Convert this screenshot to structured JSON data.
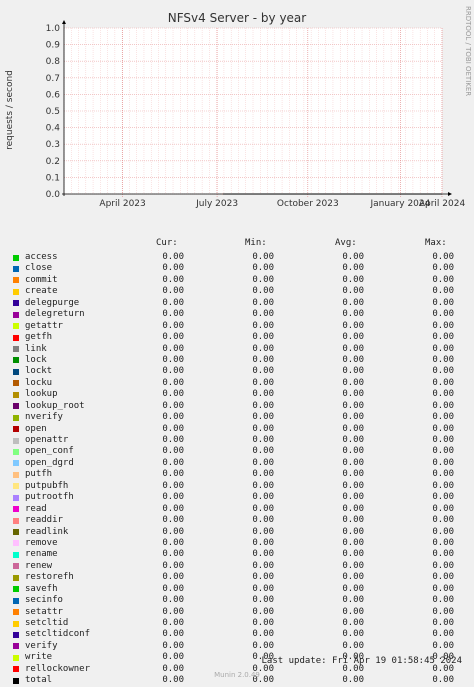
{
  "chart_data": {
    "type": "line",
    "title": "NFSv4 Server - by year",
    "ylabel": "requests / second",
    "xlabel": "",
    "ylim": [
      0,
      1
    ],
    "yticks": [
      "0.0",
      "0.1",
      "0.2",
      "0.3",
      "0.4",
      "0.5",
      "0.6",
      "0.7",
      "0.8",
      "0.9",
      "1.0"
    ],
    "xticks": [
      "April 2023",
      "July 2023",
      "October 2023",
      "January 2024",
      "April 2024"
    ],
    "grid": true,
    "watermark": "RRDTOOL / TOBI OETIKER",
    "series": [
      {
        "name": "access",
        "color": "#00cc00",
        "cur": "0.00",
        "min": "0.00",
        "avg": "0.00",
        "max": "0.00"
      },
      {
        "name": "close",
        "color": "#0066b3",
        "cur": "0.00",
        "min": "0.00",
        "avg": "0.00",
        "max": "0.00"
      },
      {
        "name": "commit",
        "color": "#ff8000",
        "cur": "0.00",
        "min": "0.00",
        "avg": "0.00",
        "max": "0.00"
      },
      {
        "name": "create",
        "color": "#ffcc00",
        "cur": "0.00",
        "min": "0.00",
        "avg": "0.00",
        "max": "0.00"
      },
      {
        "name": "delegpurge",
        "color": "#330099",
        "cur": "0.00",
        "min": "0.00",
        "avg": "0.00",
        "max": "0.00"
      },
      {
        "name": "delegreturn",
        "color": "#990099",
        "cur": "0.00",
        "min": "0.00",
        "avg": "0.00",
        "max": "0.00"
      },
      {
        "name": "getattr",
        "color": "#ccff00",
        "cur": "0.00",
        "min": "0.00",
        "avg": "0.00",
        "max": "0.00"
      },
      {
        "name": "getfh",
        "color": "#ff0000",
        "cur": "0.00",
        "min": "0.00",
        "avg": "0.00",
        "max": "0.00"
      },
      {
        "name": "link",
        "color": "#808080",
        "cur": "0.00",
        "min": "0.00",
        "avg": "0.00",
        "max": "0.00"
      },
      {
        "name": "lock",
        "color": "#008f00",
        "cur": "0.00",
        "min": "0.00",
        "avg": "0.00",
        "max": "0.00"
      },
      {
        "name": "lockt",
        "color": "#00487d",
        "cur": "0.00",
        "min": "0.00",
        "avg": "0.00",
        "max": "0.00"
      },
      {
        "name": "locku",
        "color": "#b35a00",
        "cur": "0.00",
        "min": "0.00",
        "avg": "0.00",
        "max": "0.00"
      },
      {
        "name": "lookup",
        "color": "#b38f00",
        "cur": "0.00",
        "min": "0.00",
        "avg": "0.00",
        "max": "0.00"
      },
      {
        "name": "lookup_root",
        "color": "#6b006b",
        "cur": "0.00",
        "min": "0.00",
        "avg": "0.00",
        "max": "0.00"
      },
      {
        "name": "nverify",
        "color": "#8fb300",
        "cur": "0.00",
        "min": "0.00",
        "avg": "0.00",
        "max": "0.00"
      },
      {
        "name": "open",
        "color": "#b30000",
        "cur": "0.00",
        "min": "0.00",
        "avg": "0.00",
        "max": "0.00"
      },
      {
        "name": "openattr",
        "color": "#bebebe",
        "cur": "0.00",
        "min": "0.00",
        "avg": "0.00",
        "max": "0.00"
      },
      {
        "name": "open_conf",
        "color": "#80ff80",
        "cur": "0.00",
        "min": "0.00",
        "avg": "0.00",
        "max": "0.00"
      },
      {
        "name": "open_dgrd",
        "color": "#80c9ff",
        "cur": "0.00",
        "min": "0.00",
        "avg": "0.00",
        "max": "0.00"
      },
      {
        "name": "putfh",
        "color": "#ffc080",
        "cur": "0.00",
        "min": "0.00",
        "avg": "0.00",
        "max": "0.00"
      },
      {
        "name": "putpubfh",
        "color": "#ffe680",
        "cur": "0.00",
        "min": "0.00",
        "avg": "0.00",
        "max": "0.00"
      },
      {
        "name": "putrootfh",
        "color": "#aa80ff",
        "cur": "0.00",
        "min": "0.00",
        "avg": "0.00",
        "max": "0.00"
      },
      {
        "name": "read",
        "color": "#ee00cc",
        "cur": "0.00",
        "min": "0.00",
        "avg": "0.00",
        "max": "0.00"
      },
      {
        "name": "readdir",
        "color": "#ff8080",
        "cur": "0.00",
        "min": "0.00",
        "avg": "0.00",
        "max": "0.00"
      },
      {
        "name": "readlink",
        "color": "#666600",
        "cur": "0.00",
        "min": "0.00",
        "avg": "0.00",
        "max": "0.00"
      },
      {
        "name": "remove",
        "color": "#ffbfff",
        "cur": "0.00",
        "min": "0.00",
        "avg": "0.00",
        "max": "0.00"
      },
      {
        "name": "rename",
        "color": "#00ffcc",
        "cur": "0.00",
        "min": "0.00",
        "avg": "0.00",
        "max": "0.00"
      },
      {
        "name": "renew",
        "color": "#cc6699",
        "cur": "0.00",
        "min": "0.00",
        "avg": "0.00",
        "max": "0.00"
      },
      {
        "name": "restorefh",
        "color": "#999900",
        "cur": "0.00",
        "min": "0.00",
        "avg": "0.00",
        "max": "0.00"
      },
      {
        "name": "savefh",
        "color": "#00cc00",
        "cur": "0.00",
        "min": "0.00",
        "avg": "0.00",
        "max": "0.00"
      },
      {
        "name": "secinfo",
        "color": "#0066b3",
        "cur": "0.00",
        "min": "0.00",
        "avg": "0.00",
        "max": "0.00"
      },
      {
        "name": "setattr",
        "color": "#ff8000",
        "cur": "0.00",
        "min": "0.00",
        "avg": "0.00",
        "max": "0.00"
      },
      {
        "name": "setcltid",
        "color": "#ffcc00",
        "cur": "0.00",
        "min": "0.00",
        "avg": "0.00",
        "max": "0.00"
      },
      {
        "name": "setcltidconf",
        "color": "#330099",
        "cur": "0.00",
        "min": "0.00",
        "avg": "0.00",
        "max": "0.00"
      },
      {
        "name": "verify",
        "color": "#990099",
        "cur": "0.00",
        "min": "0.00",
        "avg": "0.00",
        "max": "0.00"
      },
      {
        "name": "write",
        "color": "#ccff00",
        "cur": "0.00",
        "min": "0.00",
        "avg": "0.00",
        "max": "0.00"
      },
      {
        "name": "rellockowner",
        "color": "#ff0000",
        "cur": "0.00",
        "min": "0.00",
        "avg": "0.00",
        "max": "0.00"
      },
      {
        "name": "total",
        "color": "#000000",
        "cur": "0.00",
        "min": "0.00",
        "avg": "0.00",
        "max": "0.00"
      }
    ]
  },
  "legend_header": {
    "cur": "Cur:",
    "min": "Min:",
    "avg": "Avg:",
    "max": "Max:"
  },
  "footer": {
    "last_update": "Last update:  Fri Apr 19 01:58:45 2024",
    "version": "Munin 2.0.49"
  }
}
